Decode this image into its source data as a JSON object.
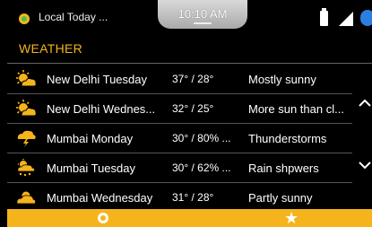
{
  "statusbar": {
    "app_title": "Local Today ...",
    "time": "10:10 AM",
    "icons": [
      "app-icon",
      "battery-icon",
      "signal-icon",
      "bluetooth-icon"
    ]
  },
  "section": {
    "title": "WEATHER"
  },
  "rows": [
    {
      "city": "New Delhi Tuesday",
      "temp": "37° / 28°",
      "condition": "Mostly sunny",
      "icon": "sun-cloud-icon"
    },
    {
      "city": "New Delhi Wednes...",
      "temp": "32° / 25°",
      "condition": "More sun than cl...",
      "icon": "sun-cloud-icon"
    },
    {
      "city": "Mumbai Monday",
      "temp": "30° / 80% ...",
      "condition": "Thunderstorms",
      "icon": "thunderstorm-icon"
    },
    {
      "city": "Mumbai Tuesday",
      "temp": "30° / 62% ...",
      "condition": "Rain shpwers",
      "icon": "rain-icon"
    },
    {
      "city": "Mumbai Wednesday",
      "temp": "31° / 28°",
      "condition": "Partly sunny",
      "icon": "partly-sunny-icon"
    }
  ],
  "bottombar": {
    "icons": [
      "app-icon",
      "star-icon"
    ],
    "star_glyph": "★"
  },
  "colors": {
    "accent": "#f5b41c",
    "background": "#000000",
    "divider": "#555555"
  }
}
